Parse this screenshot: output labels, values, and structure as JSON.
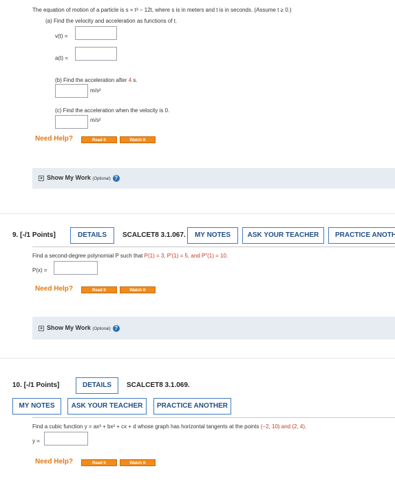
{
  "q8": {
    "statement": "The equation of motion of a particle is  s = t³ − 12t,  where s is in meters and t is in seconds. (Assume t ≥ 0.)",
    "part_a": "(a) Find the velocity and acceleration as functions of t.",
    "v_label": "v(t) =",
    "a_label": "a(t) =",
    "part_b": "(b) Find the acceleration after",
    "part_b_value": "4",
    "part_b_tail": "s.",
    "unit": "m/s²",
    "part_c": "(c) Find the acceleration when the velocity is 0.",
    "need_help": "Need Help?",
    "read_it": "Read It",
    "watch_it": "Watch It",
    "show_work": "Show My Work",
    "optional": "(Optional)"
  },
  "q9": {
    "number": "9.  [-/1 Points]",
    "details": "DETAILS",
    "code": "SCALCET8 3.1.067.",
    "my_notes": "MY NOTES",
    "ask_teacher": "ASK YOUR TEACHER",
    "practice": "PRACTICE ANOTH",
    "statement_pre": "Find a second-degree polynomial P such that",
    "conditions": "P(1) = 3, P′(1) = 5,  and  P″(1) = 10.",
    "p_label": "P(x) =",
    "need_help": "Need Help?",
    "read_it": "Read It",
    "watch_it": "Watch It",
    "show_work": "Show My Work",
    "optional": "(Optional)"
  },
  "q10": {
    "number": "10.  [-/1 Points]",
    "details": "DETAILS",
    "code": "SCALCET8 3.1.069.",
    "my_notes": "MY NOTES",
    "ask_teacher": "ASK YOUR TEACHER",
    "practice": "PRACTICE ANOTHER",
    "statement_pre": "Find a cubic function  y = ax³ + bx² + cx + d  whose graph has horizontal tangents at the points",
    "points": "(−2, 10) and (2, 4).",
    "y_label": "y =",
    "need_help": "Need Help?",
    "read_it": "Read It",
    "watch_it": "Watch It"
  },
  "colors": {
    "accent_blue": "#3f7cc1",
    "need_help_orange": "#e27a11",
    "button_orange": "#f28a1c",
    "panel_gray": "#e6ecf2"
  },
  "icons": {
    "expand": "plus-box-icon",
    "help": "question-circle-icon"
  }
}
